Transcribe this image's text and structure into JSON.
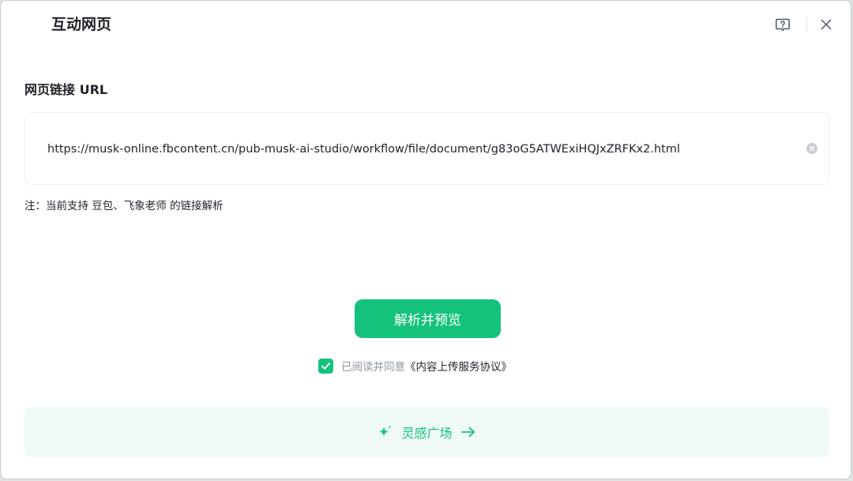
{
  "dialog": {
    "title": "互动网页",
    "help_icon": "question-help-icon",
    "close_icon": "close-icon"
  },
  "url_section": {
    "label": "网页链接 URL",
    "value": "https://musk-online.fbcontent.cn/pub-musk-ai-studio/workflow/file/document/g83oG5ATWExiHQJxZRFKx2.html",
    "clear_icon": "clear-circle-icon"
  },
  "note": "注：当前支持 豆包、飞象老师 的链接解析",
  "primary_button": "解析并预览",
  "agreement": {
    "checked": true,
    "text": "已阅读并同意",
    "link": "《内容上传服务协议》"
  },
  "inspiration": {
    "label": "灵感广场",
    "icon": "sparkle-icon",
    "arrow_icon": "arrow-right-icon"
  },
  "colors": {
    "accent": "#14c27c",
    "accent_light_bg": "#effaf5",
    "text_primary": "#1f2329",
    "text_secondary": "#8f959e"
  }
}
